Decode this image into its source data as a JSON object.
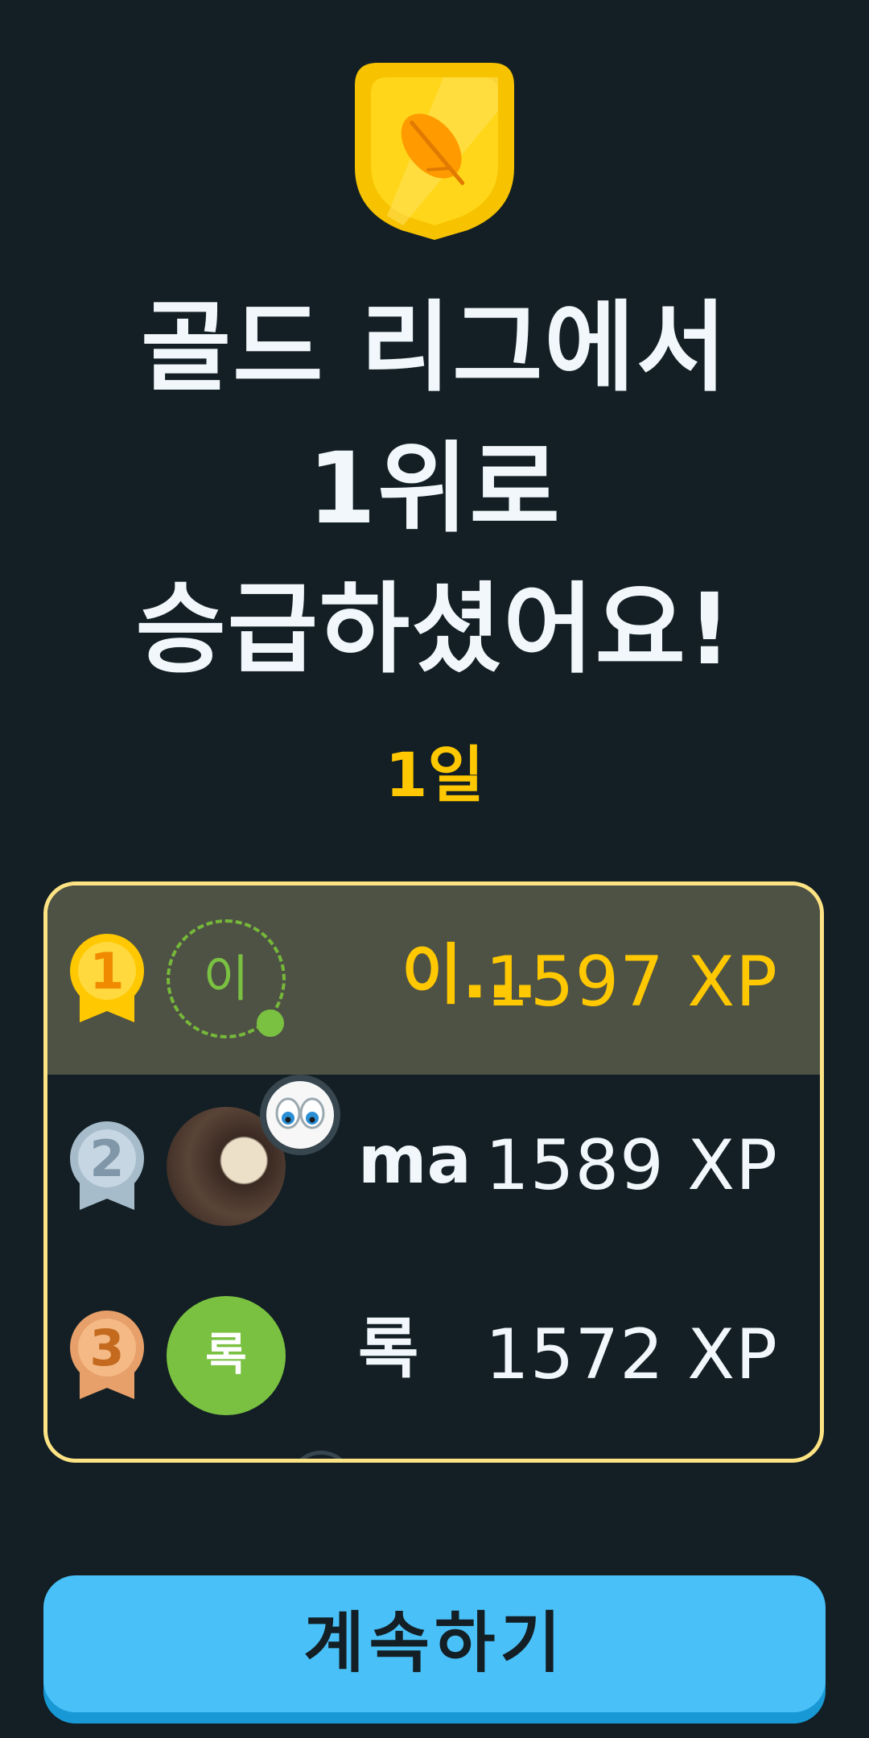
{
  "header": {
    "badge_icon": "gold-league-feather-shield-icon",
    "title_lines": [
      "골드 리그에서",
      "1위로",
      "승급하셨어요!"
    ],
    "days_left": "1일"
  },
  "leaderboard": {
    "rows": [
      {
        "rank": "1",
        "avatar_text": "이",
        "name": "이...",
        "xp": "1597 XP",
        "medal": "gold",
        "current_user": true
      },
      {
        "rank": "2",
        "avatar_text": "",
        "name": "ma",
        "xp": "1589 XP",
        "medal": "silver",
        "current_user": false
      },
      {
        "rank": "3",
        "avatar_text": "록",
        "name": "록",
        "xp": "1572 XP",
        "medal": "bronze",
        "current_user": false
      }
    ]
  },
  "continue_button": {
    "label": "계속하기"
  },
  "colors": {
    "background": "#131f24",
    "gold_text": "#ffc800",
    "highlight_row": "#4e5244",
    "board_border": "#fde383",
    "button": "#49c0f8",
    "button_shadow": "#1899d6",
    "green_avatar": "#7ac142"
  }
}
